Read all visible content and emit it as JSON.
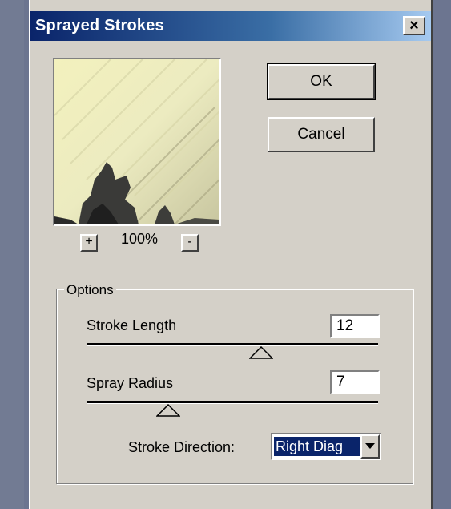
{
  "window": {
    "title": "Sprayed Strokes",
    "close_label": "×"
  },
  "preview": {
    "zoom_in_label": "+",
    "zoom_out_label": "-",
    "zoom_level": "100%"
  },
  "buttons": {
    "ok_label": "OK",
    "cancel_label": "Cancel"
  },
  "options": {
    "group_label": "Options",
    "stroke_length": {
      "label": "Stroke Length",
      "value": "12",
      "slider_fraction": 0.6
    },
    "spray_radius": {
      "label": "Spray Radius",
      "value": "7",
      "slider_fraction": 0.28
    },
    "stroke_direction": {
      "label": "Stroke Direction:",
      "selected": "Right Diag"
    }
  },
  "icons": {
    "close": "close-icon",
    "dropdown": "chevron-down-icon",
    "slider_thumb": "triangle-up-icon"
  }
}
